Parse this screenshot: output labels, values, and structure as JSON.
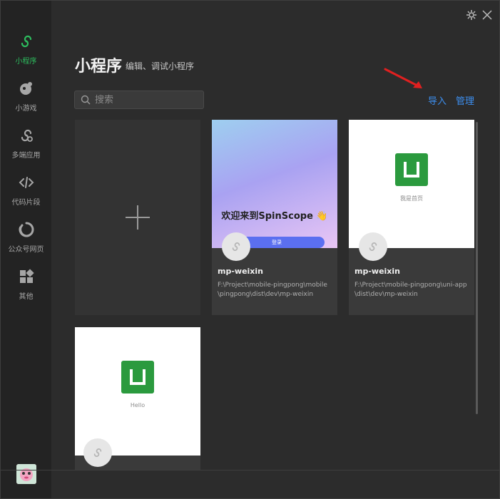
{
  "sidebar": {
    "items": [
      {
        "label": "小程序",
        "icon": "mini-program-icon",
        "active": true
      },
      {
        "label": "小游戏",
        "icon": "mini-game-icon"
      },
      {
        "label": "多端应用",
        "icon": "multi-platform-icon"
      },
      {
        "label": "代码片段",
        "icon": "code-snippet-icon"
      },
      {
        "label": "公众号网页",
        "icon": "official-account-icon"
      },
      {
        "label": "其他",
        "icon": "other-icon"
      }
    ],
    "avatar": "avatar"
  },
  "header": {
    "title": "小程序",
    "subtitle": "编辑、调试小程序"
  },
  "search": {
    "placeholder": "搜索"
  },
  "actions": {
    "import": "导入",
    "manage": "管理"
  },
  "projects": [
    {
      "name": "mp-weixin",
      "path": "F:\\Project\\mobile-pingpong\\mobile\\pingpong\\dist\\dev\\mp-weixin",
      "preview_title": "欢迎来到SpinScope 👋",
      "preview_button": "登录"
    },
    {
      "name": "mp-weixin",
      "path": "F:\\Project\\mobile-pingpong\\uni-app\\dist\\dev\\mp-weixin",
      "preview_caption": "我是首页"
    },
    {
      "name": "",
      "path": "",
      "preview_caption": "Hello"
    }
  ],
  "colors": {
    "accent": "#2dbf5f",
    "link": "#3d8ff0",
    "uni_green": "#2b9a3e"
  }
}
